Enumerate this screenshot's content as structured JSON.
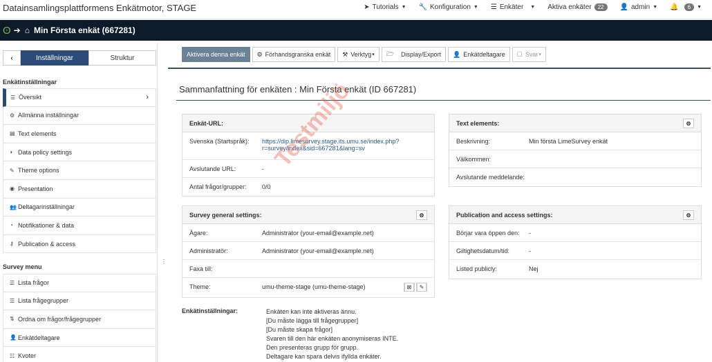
{
  "app": {
    "brand": "Datainsamlingsplattformens Enkätmotor, STAGE",
    "survey_title": "Min Första enkät (667281)"
  },
  "topnav": {
    "tutorials": "Tutorials",
    "konfiguration": "Konfiguration",
    "enkater": "Enkäter",
    "aktiva": "Aktiva enkäter",
    "aktiva_count": "22",
    "admin": "admin",
    "notifications_count": "6"
  },
  "sidebar": {
    "tab_settings": "Inställningar",
    "tab_structure": "Struktur",
    "section_settings": "Enkätinställningar",
    "settings_items": [
      {
        "label": "Översikt",
        "icon": "list-icon"
      },
      {
        "label": "Allmänna inställningar",
        "icon": "gears-icon"
      },
      {
        "label": "Text elements",
        "icon": "file-text-icon"
      },
      {
        "label": "Data policy settings",
        "icon": "shield-icon"
      },
      {
        "label": "Theme options",
        "icon": "paint-brush-icon"
      },
      {
        "label": "Presentation",
        "icon": "eye-icon"
      },
      {
        "label": "Deltagarinställningar",
        "icon": "users-icon"
      },
      {
        "label": "Notifikationer & data",
        "icon": "rss-icon"
      },
      {
        "label": "Publication & access",
        "icon": "key-icon"
      }
    ],
    "section_menu": "Survey menu",
    "menu_items": [
      {
        "label": "Lista frågor",
        "icon": "list-icon"
      },
      {
        "label": "Lista frågegrupper",
        "icon": "list-icon"
      },
      {
        "label": "Ordna om frågor/frågegrupper",
        "icon": "sort-icon"
      },
      {
        "label": "Enkätdeltagare",
        "icon": "user-icon"
      },
      {
        "label": "Kvoter",
        "icon": "tasks-icon"
      }
    ]
  },
  "toolbar": {
    "activate": "Aktivera denna enkät",
    "preview": "Förhandsgranska enkät",
    "tools": "Verktyg",
    "display_export": "Display/Export",
    "participants": "Enkätdeltagare",
    "responses": "Svar"
  },
  "main": {
    "title": "Sammanfattning för enkäten : Min Första enkät (ID 667281)",
    "watermark": "Testmiljö",
    "url_panel": {
      "heading": "Enkät-URL:",
      "rows": [
        {
          "label": "Svenska (Startspråk):",
          "value_line1": "https://dip.limesurvey.stage.its.umu.se/index.php?",
          "value_line2": "r=survey/index&sid=667281&lang=sv"
        },
        {
          "label": "Avslutande URL:",
          "value": "-"
        },
        {
          "label": "Antal frågor/grupper:",
          "value": "0/0"
        }
      ]
    },
    "text_panel": {
      "heading": "Text elements:",
      "rows": [
        {
          "label": "Beskrivning:",
          "value": "Min första LimeSurvey enkät"
        },
        {
          "label": "Välkommen:",
          "value": ""
        },
        {
          "label": "Avslutande meddelande:",
          "value": ""
        }
      ]
    },
    "general_panel": {
      "heading": "Survey general settings:",
      "rows": [
        {
          "label": "Ägare:",
          "value": "Administrator (your-email@example.net)"
        },
        {
          "label": "Administratör:",
          "value": "Administrator (your-email@example.net)"
        },
        {
          "label": "Faxa till:",
          "value": ""
        },
        {
          "label": "Theme:",
          "value": "umu-theme-stage (umu-theme-stage)"
        }
      ]
    },
    "publication_panel": {
      "heading": "Publication and access settings:",
      "rows": [
        {
          "label": "Börjar vara öppen den:",
          "value": "-"
        },
        {
          "label": "Giltighetsdatum/tid:",
          "value": "-"
        },
        {
          "label": "Listed publicly:",
          "value": "Nej"
        }
      ]
    },
    "enk_label": "Enkätinställningar:",
    "enk_lines": [
      "Enkäten kan inte aktiveras ännu.",
      "[Du måste lägga till frågegrupper]",
      "[Du måste skapa frågor]",
      "Svaren till den här enkäten anonymiseras INTE.",
      "Den presenteras grupp för grupp.",
      "Deltagare kan spara delvis ifyllda enkäter."
    ]
  }
}
